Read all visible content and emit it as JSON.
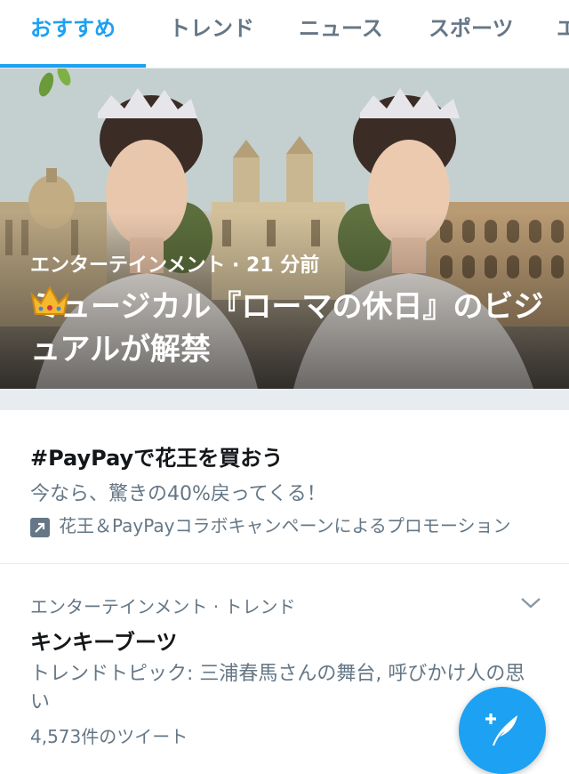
{
  "tabs": [
    {
      "label": "おすすめ",
      "active": true
    },
    {
      "label": "トレンド",
      "active": false
    },
    {
      "label": "ニュース",
      "active": false
    },
    {
      "label": "スポーツ",
      "active": false
    },
    {
      "label": "エ",
      "active": false
    }
  ],
  "hero": {
    "meta": "エンターテインメント · 21 分前",
    "title": "ミュージカル『ローマの休日』のビジュアルが解禁",
    "title_emoji_icon": "crown-icon"
  },
  "promoted": {
    "hashtag": "#PayPayで花王を買おう",
    "description": "今なら、驚きの40%戻ってくる！",
    "promotion_line": "花王＆PayPayコラボキャンペーンによるプロモーション",
    "icon": "promoted-arrow-icon"
  },
  "trend": {
    "meta": "エンターテインメント · トレンド",
    "name": "キンキーブーツ",
    "description": "トレンドトピック: 三浦春馬さんの舞台, 呼びかけ人の思い",
    "count": "4,573件のツイート",
    "menu_icon": "chevron-down-icon"
  },
  "fab": {
    "icon": "compose-tweet-icon"
  },
  "colors": {
    "accent": "#1da1f2",
    "secondary_text": "#657786",
    "divider": "#e6ecf0"
  }
}
